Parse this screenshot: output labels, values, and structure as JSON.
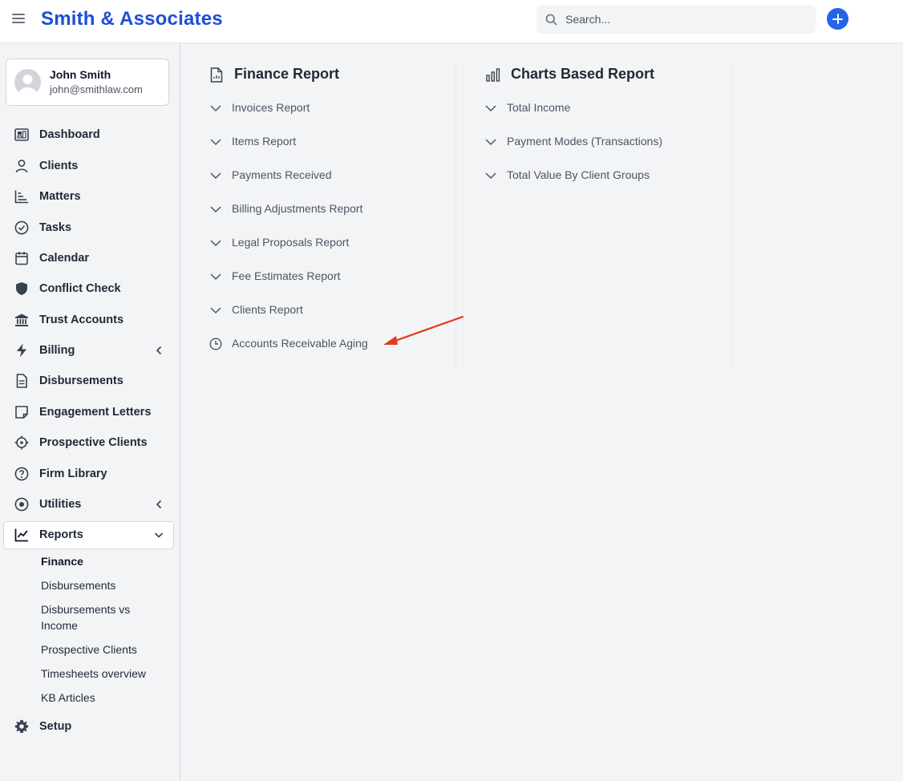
{
  "header": {
    "brand": "Smith & Associates",
    "search_placeholder": "Search...",
    "accent_color": "#2563eb",
    "brand_color": "#1d4ed8"
  },
  "user": {
    "name": "John Smith",
    "email": "john@smithlaw.com"
  },
  "sidebar": {
    "items": [
      {
        "label": "Dashboard",
        "icon": "dashboard-icon"
      },
      {
        "label": "Clients",
        "icon": "user-icon"
      },
      {
        "label": "Matters",
        "icon": "matters-chart-icon"
      },
      {
        "label": "Tasks",
        "icon": "check-circle-icon"
      },
      {
        "label": "Calendar",
        "icon": "calendar-icon"
      },
      {
        "label": "Conflict Check",
        "icon": "shield-icon"
      },
      {
        "label": "Trust Accounts",
        "icon": "bank-icon"
      },
      {
        "label": "Billing",
        "icon": "lightning-icon",
        "has_submenu": true
      },
      {
        "label": "Disbursements",
        "icon": "document-icon"
      },
      {
        "label": "Engagement Letters",
        "icon": "sticky-note-icon"
      },
      {
        "label": "Prospective Clients",
        "icon": "crosshair-icon"
      },
      {
        "label": "Firm Library",
        "icon": "question-circle-icon"
      },
      {
        "label": "Utilities",
        "icon": "radio-circle-icon",
        "has_submenu": true
      },
      {
        "label": "Reports",
        "icon": "line-chart-icon",
        "expanded": true
      },
      {
        "label": "Setup",
        "icon": "gear-icon"
      }
    ],
    "reports_submenu": [
      {
        "label": "Finance",
        "current": true
      },
      {
        "label": "Disbursements"
      },
      {
        "label": "Disbursements vs Income"
      },
      {
        "label": "Prospective Clients"
      },
      {
        "label": "Timesheets overview"
      },
      {
        "label": "KB Articles"
      }
    ]
  },
  "main": {
    "finance": {
      "title": "Finance Report",
      "links": [
        "Invoices Report",
        "Items Report",
        "Payments Received",
        "Billing Adjustments Report",
        "Legal Proposals Report",
        "Fee Estimates Report",
        "Clients Report",
        "Accounts Receivable Aging"
      ]
    },
    "charts": {
      "title": "Charts Based Report",
      "links": [
        "Total Income",
        "Payment Modes (Transactions)",
        "Total Value By Client Groups"
      ]
    },
    "annotation_color": "#e5391c"
  }
}
